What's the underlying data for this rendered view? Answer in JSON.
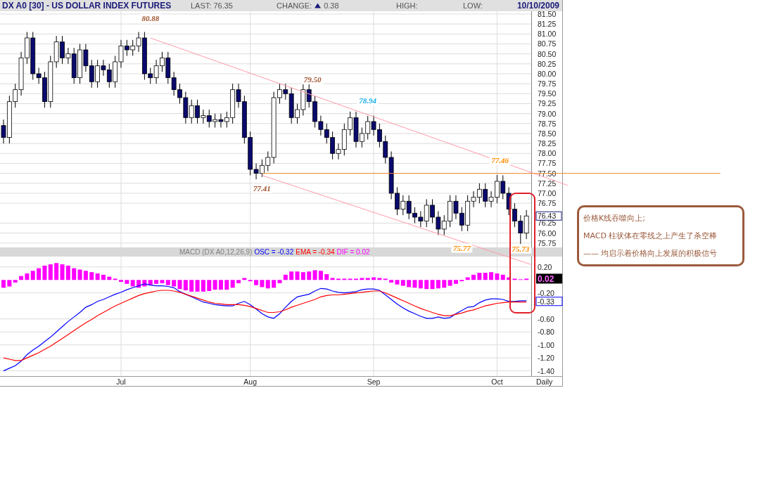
{
  "header": {
    "title": "DX A0 [30] - US DOLLAR INDEX FUTURES",
    "last": "LAST: 76.35",
    "change_label": "CHANGE:",
    "change_up": true,
    "change": "0.38",
    "high": "HIGH:",
    "low": "LOW:",
    "date": "10/10/2009"
  },
  "price_panel": {
    "last_label": "76.43",
    "chart_data": {
      "type": "candlestick",
      "grid": true,
      "ylim": [
        75.64,
        81.57
      ],
      "yticks": [
        {
          "value": 81.5,
          "label": "81.50"
        },
        {
          "value": 81.25,
          "label": "81.25"
        },
        {
          "value": 81,
          "label": "81.00"
        },
        {
          "value": 80.75,
          "label": "80.75"
        },
        {
          "value": 80.5,
          "label": "80.50"
        },
        {
          "value": 80.25,
          "label": "80.25"
        },
        {
          "value": 80,
          "label": "80.00"
        },
        {
          "value": 79.75,
          "label": "79.75"
        },
        {
          "value": 79.5,
          "label": "79.50"
        },
        {
          "value": 79.25,
          "label": "79.25"
        },
        {
          "value": 79,
          "label": "79.00"
        },
        {
          "value": 78.75,
          "label": "78.75"
        },
        {
          "value": 78.5,
          "label": "78.50"
        },
        {
          "value": 78.25,
          "label": "78.25"
        },
        {
          "value": 78,
          "label": "78.00"
        },
        {
          "value": 77.75,
          "label": "77.75"
        },
        {
          "value": 77.5,
          "label": "77.50"
        },
        {
          "value": 77.25,
          "label": "77.25"
        },
        {
          "value": 77,
          "label": "77.00"
        },
        {
          "value": 76.75,
          "label": "76.75"
        },
        {
          "value": 76.25,
          "label": "76.25"
        },
        {
          "value": 76,
          "label": "76.00"
        },
        {
          "value": 75.75,
          "label": "75.75"
        }
      ],
      "ohlc": [
        [
          78.7,
          78.85,
          78.25,
          78.4
        ],
        [
          78.4,
          79.45,
          78.25,
          79.3
        ],
        [
          79.3,
          79.75,
          79.15,
          79.6
        ],
        [
          79.6,
          80.55,
          79.45,
          80.4
        ],
        [
          80.4,
          81.05,
          80.25,
          80.9
        ],
        [
          80.9,
          81.05,
          79.85,
          80.0
        ],
        [
          80.0,
          80.15,
          79.75,
          79.9
        ],
        [
          79.9,
          80.05,
          79.15,
          79.3
        ],
        [
          79.3,
          80.45,
          79.15,
          80.3
        ],
        [
          80.3,
          80.95,
          80.15,
          80.8
        ],
        [
          80.8,
          80.95,
          80.25,
          80.4
        ],
        [
          80.4,
          80.65,
          80.25,
          80.5
        ],
        [
          80.5,
          80.65,
          79.75,
          79.9
        ],
        [
          79.9,
          80.75,
          79.75,
          80.6
        ],
        [
          80.6,
          80.75,
          80.05,
          80.2
        ],
        [
          80.2,
          80.35,
          79.65,
          79.8
        ],
        [
          79.8,
          80.35,
          79.65,
          80.2
        ],
        [
          80.2,
          80.35,
          79.95,
          80.1
        ],
        [
          80.1,
          80.25,
          79.65,
          79.8
        ],
        [
          79.8,
          80.45,
          79.65,
          80.3
        ],
        [
          80.3,
          80.85,
          80.15,
          80.7
        ],
        [
          80.7,
          80.85,
          80.45,
          80.6
        ],
        [
          80.6,
          80.85,
          80.45,
          80.7
        ],
        [
          80.7,
          81.05,
          80.55,
          80.9
        ],
        [
          80.9,
          81.05,
          79.85,
          80.0
        ],
        [
          80.0,
          80.15,
          79.75,
          79.9
        ],
        [
          79.9,
          80.35,
          79.75,
          80.2
        ],
        [
          80.2,
          80.55,
          80.05,
          80.4
        ],
        [
          80.4,
          80.55,
          79.75,
          79.9
        ],
        [
          79.9,
          80.05,
          79.45,
          79.6
        ],
        [
          79.6,
          79.75,
          79.25,
          79.4
        ],
        [
          79.4,
          79.55,
          78.75,
          78.9
        ],
        [
          78.9,
          79.35,
          78.75,
          79.2
        ],
        [
          79.2,
          79.35,
          78.75,
          78.9
        ],
        [
          78.9,
          79.1,
          78.75,
          78.95
        ],
        [
          78.95,
          79.1,
          78.65,
          78.8
        ],
        [
          78.8,
          79.0,
          78.65,
          78.85
        ],
        [
          78.85,
          79.0,
          78.65,
          78.8
        ],
        [
          78.8,
          79.05,
          78.65,
          78.9
        ],
        [
          78.9,
          79.75,
          78.75,
          79.6
        ],
        [
          79.6,
          79.75,
          79.15,
          79.3
        ],
        [
          79.3,
          79.45,
          78.25,
          78.4
        ],
        [
          78.4,
          78.55,
          77.45,
          77.6
        ],
        [
          77.6,
          77.75,
          77.35,
          77.5
        ],
        [
          77.5,
          77.85,
          77.41,
          77.7
        ],
        [
          77.7,
          78.05,
          77.55,
          77.9
        ],
        [
          77.9,
          79.55,
          77.75,
          79.4
        ],
        [
          79.4,
          79.75,
          79.25,
          79.6
        ],
        [
          79.6,
          79.75,
          79.35,
          79.5
        ],
        [
          79.5,
          79.65,
          78.75,
          78.9
        ],
        [
          78.9,
          79.25,
          78.75,
          79.1
        ],
        [
          79.1,
          79.75,
          78.95,
          79.6
        ],
        [
          79.6,
          79.75,
          79.15,
          79.3
        ],
        [
          79.3,
          79.45,
          78.65,
          78.8
        ],
        [
          78.8,
          78.95,
          78.45,
          78.6
        ],
        [
          78.6,
          78.75,
          78.25,
          78.4
        ],
        [
          78.4,
          78.55,
          77.85,
          78.0
        ],
        [
          78.0,
          78.25,
          77.85,
          78.1
        ],
        [
          78.1,
          78.75,
          77.95,
          78.6
        ],
        [
          78.6,
          79.05,
          78.45,
          78.9
        ],
        [
          78.9,
          79.05,
          78.15,
          78.3
        ],
        [
          78.3,
          78.65,
          78.15,
          78.5
        ],
        [
          78.5,
          78.94,
          78.35,
          78.8
        ],
        [
          78.8,
          78.95,
          78.45,
          78.6
        ],
        [
          78.6,
          78.75,
          78.15,
          78.3
        ],
        [
          78.3,
          78.45,
          77.75,
          77.9
        ],
        [
          77.9,
          78.05,
          76.85,
          77.0
        ],
        [
          77.0,
          77.15,
          76.45,
          76.6
        ],
        [
          76.6,
          76.95,
          76.45,
          76.8
        ],
        [
          76.8,
          76.95,
          76.35,
          76.5
        ],
        [
          76.5,
          76.65,
          76.25,
          76.4
        ],
        [
          76.4,
          76.55,
          76.15,
          76.3
        ],
        [
          76.3,
          76.85,
          76.15,
          76.7
        ],
        [
          76.7,
          76.85,
          76.25,
          76.4
        ],
        [
          76.4,
          76.55,
          75.95,
          76.1
        ],
        [
          76.1,
          76.45,
          75.95,
          76.3
        ],
        [
          76.3,
          76.95,
          76.15,
          76.8
        ],
        [
          76.8,
          76.95,
          76.35,
          76.5
        ],
        [
          76.5,
          76.65,
          76.05,
          76.2
        ],
        [
          76.2,
          76.95,
          76.05,
          76.8
        ],
        [
          76.8,
          77.05,
          76.65,
          76.9
        ],
        [
          76.9,
          77.25,
          76.75,
          77.1
        ],
        [
          77.1,
          77.25,
          76.65,
          76.8
        ],
        [
          76.8,
          77.05,
          76.65,
          76.9
        ],
        [
          76.9,
          77.46,
          76.75,
          77.3
        ],
        [
          77.3,
          77.45,
          76.85,
          77.0
        ],
        [
          77.0,
          77.15,
          76.45,
          76.6
        ],
        [
          76.6,
          76.75,
          76.15,
          76.3
        ],
        [
          76.3,
          76.45,
          75.73,
          76.0
        ],
        [
          76.0,
          76.58,
          75.85,
          76.43
        ]
      ]
    },
    "labels": [
      {
        "text": "80.88",
        "color": "#a0522d"
      },
      {
        "text": "79.50",
        "color": "#a0522d"
      },
      {
        "text": "78.94",
        "color": "#1ab0e8"
      },
      {
        "text": "77.46",
        "color": "#ff8c00"
      },
      {
        "text": "77.41",
        "color": "#a0522d"
      },
      {
        "text": "75.77",
        "color": "#ff8c00"
      },
      {
        "text": "75.73",
        "color": "#ff8c00"
      }
    ]
  },
  "macd_panel": {
    "dif_label": "0.02",
    "osc_label": "-0.33",
    "chart_data": {
      "type": "line",
      "title": "MACD (DX A0,12,26,9)",
      "grid": true,
      "ylim": [
        -1.48,
        0.36
      ],
      "yticks": [
        {
          "value": 0.2,
          "label": "0.20"
        },
        {
          "value": -0.2,
          "label": "-0.20"
        },
        {
          "value": -0.6,
          "label": "-0.60"
        },
        {
          "value": -0.8,
          "label": "-0.80"
        },
        {
          "value": -1.0,
          "label": "-1.00"
        },
        {
          "value": -1.2,
          "label": "-1.20"
        },
        {
          "value": -1.4,
          "label": "-1.40"
        }
      ],
      "categories": [
        null,
        null,
        null,
        null,
        null,
        null,
        null,
        null,
        null,
        null,
        null,
        null,
        null,
        null,
        null,
        null,
        null,
        null,
        null,
        null,
        "Jul",
        null,
        null,
        null,
        null,
        null,
        null,
        null,
        null,
        null,
        null,
        null,
        null,
        null,
        null,
        null,
        null,
        null,
        null,
        null,
        null,
        null,
        "Aug",
        null,
        null,
        null,
        null,
        null,
        null,
        null,
        null,
        null,
        null,
        null,
        null,
        null,
        null,
        null,
        null,
        null,
        null,
        null,
        null,
        "Sep",
        null,
        null,
        null,
        null,
        null,
        null,
        null,
        null,
        null,
        null,
        null,
        null,
        null,
        null,
        null,
        null,
        null,
        null,
        null,
        null,
        "Oct",
        null,
        null,
        null,
        null,
        null
      ],
      "series": [
        {
          "name": "OSC = -0.32",
          "color": "#0000ff",
          "values": [
            -1.4,
            -1.36,
            -1.32,
            -1.25,
            -1.15,
            -1.08,
            -1.02,
            -0.95,
            -0.88,
            -0.8,
            -0.72,
            -0.64,
            -0.57,
            -0.5,
            -0.42,
            -0.38,
            -0.33,
            -0.3,
            -0.26,
            -0.22,
            -0.19,
            -0.15,
            -0.12,
            -0.09,
            -0.06,
            -0.08,
            -0.09,
            -0.09,
            -0.1,
            -0.12,
            -0.18,
            -0.22,
            -0.26,
            -0.3,
            -0.34,
            -0.36,
            -0.38,
            -0.39,
            -0.4,
            -0.4,
            -0.36,
            -0.33,
            -0.38,
            -0.45,
            -0.52,
            -0.57,
            -0.59,
            -0.52,
            -0.42,
            -0.33,
            -0.26,
            -0.24,
            -0.22,
            -0.17,
            -0.13,
            -0.14,
            -0.17,
            -0.19,
            -0.2,
            -0.19,
            -0.18,
            -0.15,
            -0.14,
            -0.14,
            -0.16,
            -0.23,
            -0.3,
            -0.37,
            -0.43,
            -0.48,
            -0.52,
            -0.56,
            -0.59,
            -0.59,
            -0.57,
            -0.59,
            -0.58,
            -0.52,
            -0.47,
            -0.42,
            -0.41,
            -0.35,
            -0.31,
            -0.29,
            -0.29,
            -0.3,
            -0.33,
            -0.33,
            -0.32,
            -0.32
          ]
        },
        {
          "name": "EMA = -0.34",
          "color": "#ff0000",
          "values": [
            -1.2,
            -1.22,
            -1.24,
            -1.24,
            -1.2,
            -1.16,
            -1.12,
            -1.07,
            -1.02,
            -0.96,
            -0.9,
            -0.84,
            -0.78,
            -0.72,
            -0.66,
            -0.61,
            -0.55,
            -0.5,
            -0.45,
            -0.4,
            -0.36,
            -0.32,
            -0.28,
            -0.24,
            -0.21,
            -0.19,
            -0.17,
            -0.16,
            -0.16,
            -0.17,
            -0.19,
            -0.22,
            -0.25,
            -0.28,
            -0.31,
            -0.34,
            -0.36,
            -0.37,
            -0.38,
            -0.38,
            -0.38,
            -0.39,
            -0.41,
            -0.44,
            -0.47,
            -0.5,
            -0.5,
            -0.49,
            -0.46,
            -0.42,
            -0.39,
            -0.36,
            -0.33,
            -0.3,
            -0.26,
            -0.24,
            -0.23,
            -0.23,
            -0.22,
            -0.21,
            -0.2,
            -0.19,
            -0.18,
            -0.17,
            -0.17,
            -0.2,
            -0.24,
            -0.28,
            -0.32,
            -0.36,
            -0.4,
            -0.44,
            -0.47,
            -0.5,
            -0.53,
            -0.55,
            -0.55,
            -0.53,
            -0.51,
            -0.48,
            -0.46,
            -0.43,
            -0.4,
            -0.38,
            -0.36,
            -0.35,
            -0.34,
            -0.34,
            -0.34,
            -0.34
          ]
        },
        {
          "name": "DIF = 0.02",
          "type": "bar",
          "color": "#ff00ff",
          "values": [
            -0.12,
            -0.1,
            -0.04,
            0.06,
            0.1,
            0.14,
            0.18,
            0.22,
            0.24,
            0.26,
            0.24,
            0.22,
            0.18,
            0.16,
            0.14,
            0.12,
            0.1,
            0.08,
            0.05,
            0.02,
            -0.03,
            -0.06,
            -0.1,
            -0.12,
            -0.1,
            -0.08,
            -0.06,
            -0.05,
            -0.08,
            -0.1,
            -0.14,
            -0.16,
            -0.18,
            -0.18,
            -0.18,
            -0.17,
            -0.15,
            -0.15,
            -0.15,
            -0.12,
            -0.05,
            0.03,
            -0.02,
            -0.08,
            -0.11,
            -0.13,
            -0.12,
            -0.05,
            0.08,
            0.13,
            0.13,
            0.12,
            0.13,
            0.15,
            0.14,
            0.09,
            0.03,
            0.02,
            0.02,
            0.02,
            0.02,
            0.03,
            0.03,
            0.04,
            0.03,
            0.02,
            -0.04,
            -0.07,
            -0.09,
            -0.11,
            -0.12,
            -0.13,
            -0.14,
            -0.14,
            -0.13,
            -0.12,
            -0.09,
            -0.06,
            -0.02,
            0.04,
            0.08,
            0.11,
            0.11,
            0.12,
            0.1,
            0.08,
            0.04,
            0.02,
            0.01,
            0.02
          ]
        }
      ]
    }
  },
  "x_axis": {
    "period": "Daily"
  },
  "note": {
    "lines": [
      "价格K线吞噬向上;",
      "MACD 柱状体在零线之上产生了杀空棒",
      "—— 均启示着价格向上发展的积极信号"
    ]
  }
}
